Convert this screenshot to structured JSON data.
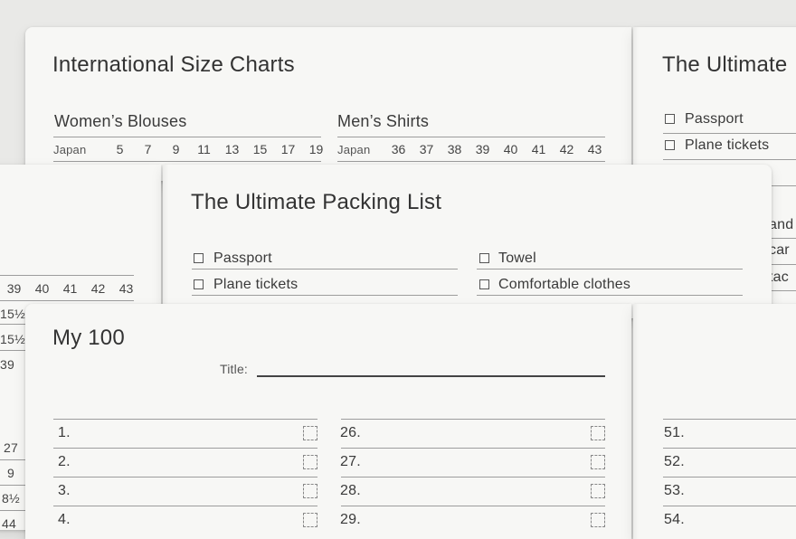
{
  "size_card": {
    "title": "International Size Charts",
    "womens": {
      "heading": "Women’s Blouses",
      "row_label": "Japan",
      "values": [
        "5",
        "7",
        "9",
        "11",
        "13",
        "15",
        "17",
        "19"
      ]
    },
    "mens": {
      "heading": "Men’s Shirts",
      "row_label": "Japan",
      "values": [
        "36",
        "37",
        "38",
        "39",
        "40",
        "41",
        "42",
        "43"
      ]
    }
  },
  "packing_card_right": {
    "title": "The Ultimate",
    "items": [
      "Passport",
      "Plane tickets"
    ],
    "cut_fragments": [
      "and",
      "car",
      "tac"
    ]
  },
  "left_card": {
    "values": [
      "39",
      "40",
      "41",
      "42",
      "43"
    ],
    "column_fragments": [
      "15½",
      "15½",
      "39",
      "27",
      "9",
      "8½",
      "44"
    ]
  },
  "packing_card": {
    "title": "The Ultimate Packing List",
    "left_items": [
      "Passport",
      "Plane tickets"
    ],
    "right_items": [
      "Towel",
      "Comfortable clothes"
    ]
  },
  "my100_card": {
    "title": "My 100",
    "title_field_label": "Title:",
    "col1": [
      "1.",
      "2.",
      "3.",
      "4."
    ],
    "col2": [
      "26.",
      "27.",
      "28.",
      "29."
    ],
    "col3": [
      "51.",
      "52.",
      "53.",
      "54."
    ]
  }
}
